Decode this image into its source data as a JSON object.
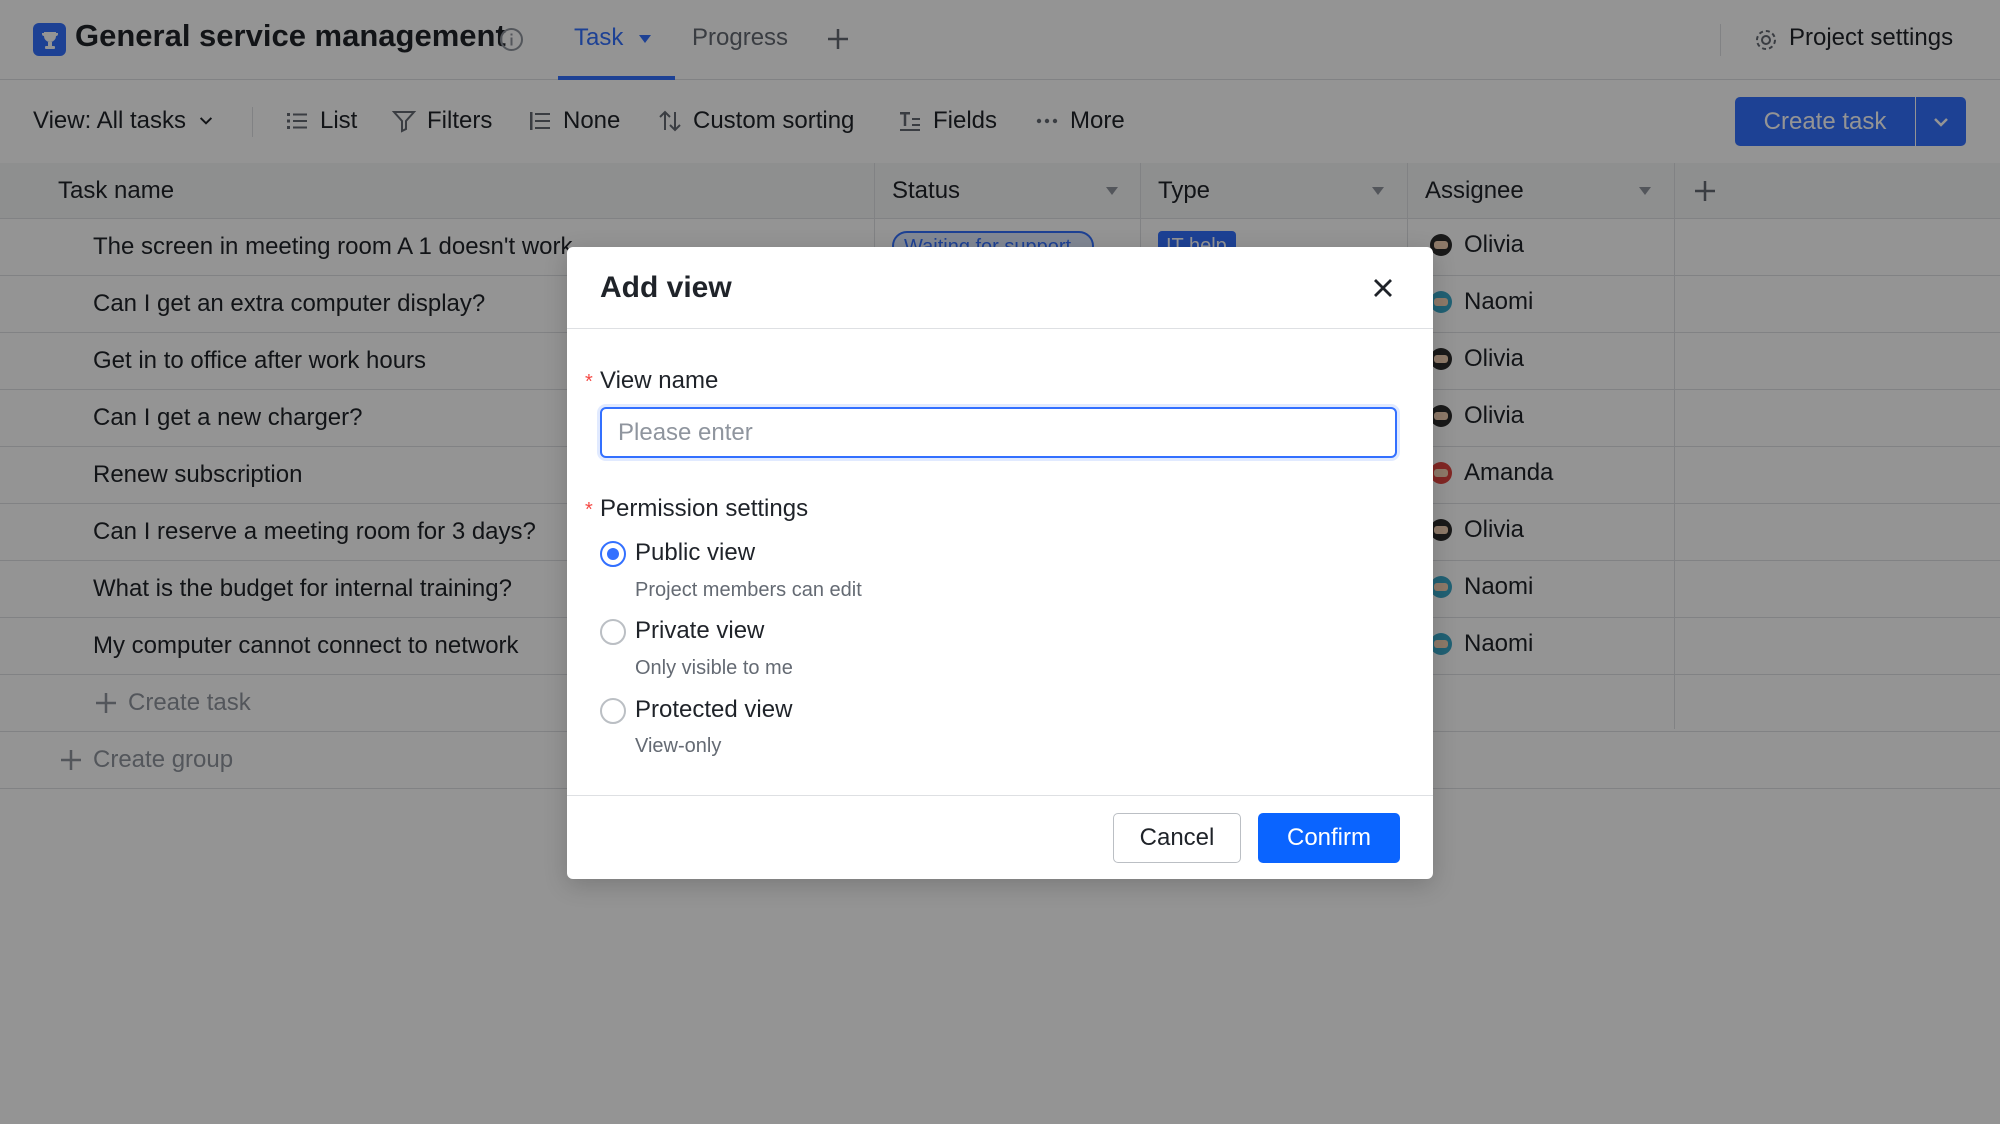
{
  "app": {
    "title": "General service management",
    "tabs": [
      {
        "label": "Task",
        "active": true
      },
      {
        "label": "Progress",
        "active": false
      }
    ],
    "settings_label": "Project settings"
  },
  "toolbar": {
    "view_label": "View: All tasks",
    "list_label": "List",
    "filters_label": "Filters",
    "group_label": "None",
    "sort_label": "Custom sorting",
    "fields_label": "Fields",
    "more_label": "More",
    "create_task_label": "Create task"
  },
  "table": {
    "columns": [
      "Task name",
      "Status",
      "Type",
      "Assignee"
    ],
    "rows": [
      {
        "task": "The screen in meeting room A 1 doesn't work",
        "status": "Waiting for support",
        "type": "IT help",
        "assignee": "Olivia"
      },
      {
        "task": "Can I get an extra computer display?",
        "assignee": "Naomi"
      },
      {
        "task": "Get in to office after work hours",
        "assignee": "Olivia"
      },
      {
        "task": "Can I get a new charger?",
        "assignee": "Olivia"
      },
      {
        "task": "Renew subscription",
        "assignee": "Amanda"
      },
      {
        "task": "Can I reserve a meeting room for 3 days?",
        "assignee": "Olivia"
      },
      {
        "task": "What is the budget for internal training?",
        "assignee": "Naomi"
      },
      {
        "task": "My computer cannot connect to network",
        "assignee": "Naomi"
      }
    ],
    "create_task_label": "Create task",
    "create_group_label": "Create group"
  },
  "modal": {
    "title": "Add view",
    "view_name_label": "View name",
    "view_name_value": "",
    "view_name_placeholder": "Please enter",
    "permission_label": "Permission settings",
    "options": [
      {
        "label": "Public view",
        "desc": "Project members can edit",
        "checked": true
      },
      {
        "label": "Private view",
        "desc": "Only visible to me",
        "checked": false
      },
      {
        "label": "Protected view",
        "desc": "View-only",
        "checked": false
      }
    ],
    "cancel_label": "Cancel",
    "confirm_label": "Confirm"
  },
  "colors": {
    "accent": "#3370ff",
    "confirm": "#0a64ff",
    "required": "#f54a45"
  }
}
